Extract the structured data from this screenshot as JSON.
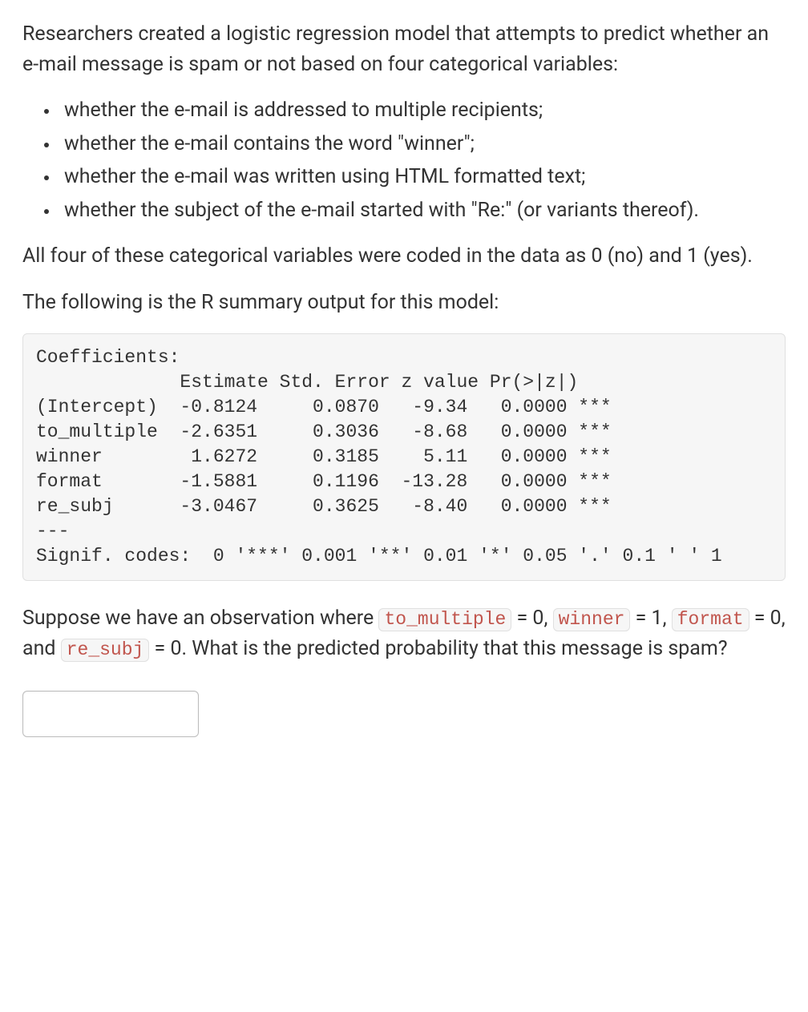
{
  "intro": "Researchers created a logistic regression model that attempts to predict whether an e-mail message is spam or not based on four categorical variables:",
  "bullets": [
    "whether the e-mail is addressed to multiple recipients;",
    "whether the e-mail contains the word \"winner\";",
    "whether the e-mail was written using HTML formatted text;",
    "whether the subject of the e-mail started with \"Re:\" (or variants thereof)."
  ],
  "coding_note": "All four of these categorical variables were coded in the data as 0 (no) and 1 (yes).",
  "summary_lead": "The following is the R summary output for this model:",
  "r_output": "Coefficients:\n             Estimate Std. Error z value Pr(>|z|)\n(Intercept)  -0.8124     0.0870   -9.34   0.0000 ***\nto_multiple  -2.6351     0.3036   -8.68   0.0000 ***\nwinner        1.6272     0.3185    5.11   0.0000 ***\nformat       -1.5881     0.1196  -13.28   0.0000 ***\nre_subj      -3.0467     0.3625   -8.40   0.0000 ***\n---\nSignif. codes:  0 '***' 0.001 '**' 0.01 '*' 0.05 '.' 0.1 ' ' 1",
  "question": {
    "part1": "Suppose we have an observation where ",
    "code1": "to_multiple",
    "part2": " = 0, ",
    "code2": "winner",
    "part3": " = 1, ",
    "code3": "format",
    "part4": " = 0, and ",
    "code4": "re_subj",
    "part5": " = 0. What is the predicted probability that this message is spam?"
  },
  "answer_value": ""
}
